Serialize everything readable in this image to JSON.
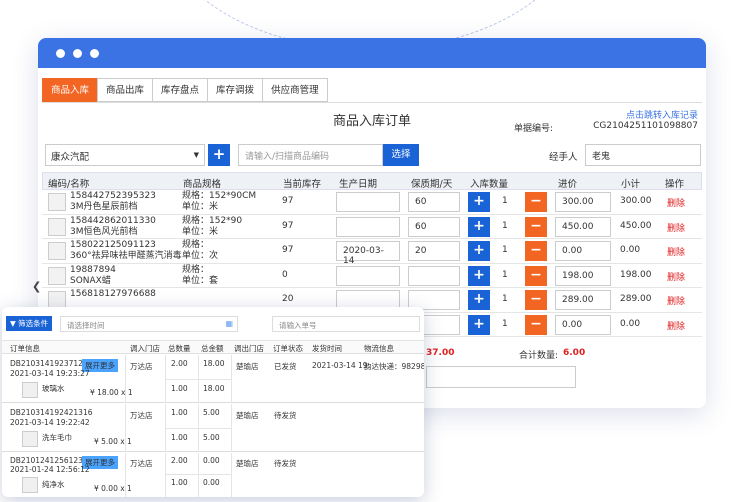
{
  "tabs": [
    "商品入库",
    "商品出库",
    "库存盘点",
    "库存调拨",
    "供应商管理"
  ],
  "page_title": "商品入库订单",
  "link_text": "点击跳转入库记录",
  "doc_label": "单据编号:",
  "doc_no": "CG2104251101098807",
  "supplier": "康众汽配",
  "search_placeholder": "请输入/扫描商品编码",
  "choose_label": "选择",
  "handler_label": "经手人",
  "handler": "老鬼",
  "headers": [
    "编码/名称",
    "商品规格",
    "当前库存",
    "生产日期",
    "保质期/天",
    "入库数量",
    "进价",
    "小计",
    "操作"
  ],
  "rows": [
    {
      "code": "158442752395323",
      "name": "3M丹色星辰前档",
      "spec1": "规格：152*90CM",
      "spec2": "单位：米",
      "stock": "97",
      "date": "",
      "shelf": "60",
      "qty": "1",
      "price": "300.00",
      "subtotal": "300.00"
    },
    {
      "code": "158442862011330",
      "name": "3M恒色风光前档",
      "spec1": "规格：152*90",
      "spec2": "单位：米",
      "stock": "97",
      "date": "",
      "shelf": "60",
      "qty": "1",
      "price": "450.00",
      "subtotal": "450.00"
    },
    {
      "code": "158022125091123",
      "name": "360°祛异味祛甲醛蒸汽消毒",
      "spec1": "规格：",
      "spec2": "单位：次",
      "stock": "97",
      "date": "2020-03-14",
      "shelf": "20",
      "qty": "1",
      "price": "0.00",
      "subtotal": "0.00"
    },
    {
      "code": "19887894",
      "name": "SONAX蜡",
      "spec1": "规格：",
      "spec2": "单位：套",
      "stock": "0",
      "date": "",
      "shelf": "",
      "qty": "1",
      "price": "198.00",
      "subtotal": "198.00"
    },
    {
      "code": "156818127976688",
      "name": "",
      "spec1": "",
      "spec2": "",
      "stock": "20",
      "date": "",
      "shelf": "",
      "qty": "1",
      "price": "289.00",
      "subtotal": "289.00"
    },
    {
      "code": "",
      "name": "",
      "spec1": "",
      "spec2": "",
      "stock": "",
      "date": "",
      "shelf": "",
      "qty": "1",
      "price": "0.00",
      "subtotal": "0.00"
    }
  ],
  "delete_label": "删除",
  "total_amount_partial": "37.00",
  "total_qty_label": "合计数量:",
  "total_qty": "6.00",
  "panel": {
    "filter_label": "筛选条件",
    "time_placeholder": "请选择时间",
    "order_placeholder": "请输入单号",
    "headers": [
      "订单信息",
      "调入门店",
      "总数量",
      "总金额",
      "调出门店",
      "订单状态",
      "发货时间",
      "物流信息"
    ],
    "expand_label": "展开更多",
    "orders": [
      {
        "no": "DB210314192371285",
        "time": "2021-03-14 19:23:27",
        "item": "玻璃水",
        "price": "¥ 18.00 x 1",
        "in_store": "万达店",
        "qty1": "2.00",
        "amt1": "18.00",
        "qty2": "1.00",
        "amt2": "18.00",
        "out_store": "楚瑜店",
        "status": "已发货",
        "ship": "2021-03-14 19:",
        "logi": "韵达快递：982982"
      },
      {
        "no": "DB210314192421316",
        "time": "2021-03-14 19:22:42",
        "item": "洗车毛巾",
        "price": "¥ 5.00 x 1",
        "in_store": "万达店",
        "qty1": "1.00",
        "amt1": "5.00",
        "qty2": "1.00",
        "amt2": "5.00",
        "out_store": "楚瑜店",
        "status": "待发货",
        "ship": "",
        "logi": ""
      },
      {
        "no": "DB210124125612314",
        "time": "2021-01-24 12:56:12",
        "item": "纯净水",
        "price": "¥ 0.00 x 1",
        "in_store": "万达店",
        "qty1": "2.00",
        "amt1": "0.00",
        "qty2": "1.00",
        "amt2": "0.00",
        "out_store": "楚瑜店",
        "status": "待发货",
        "ship": "",
        "logi": ""
      }
    ]
  }
}
